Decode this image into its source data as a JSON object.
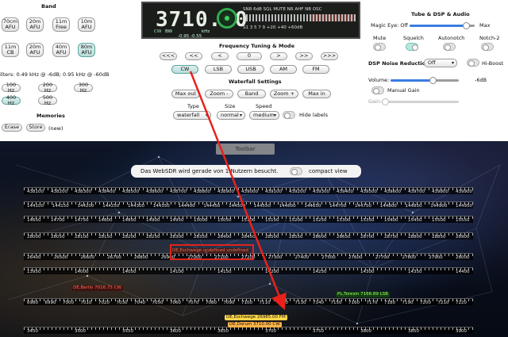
{
  "band": {
    "title": "Band",
    "buttons": [
      {
        "l1": "70cm",
        "l2": "AFU"
      },
      {
        "l1": "20m",
        "l2": "AFU"
      },
      {
        "l1": "11m",
        "l2": "Free"
      },
      {
        "l1": "10m",
        "l2": "AFU"
      },
      {
        "l1": "11m",
        "l2": "CB"
      },
      {
        "l1": "20m",
        "l2": "AFU"
      },
      {
        "l1": "40m",
        "l2": "AFU"
      },
      {
        "l1": "80m",
        "l2": "AFU"
      }
    ],
    "filters_text": "ilters: 0.49 kHz @ -6dB; 0.95 kHz @ -60dB",
    "filter_buttons": [
      "100 Hz",
      "200 Hz",
      "300 Hz",
      "400 Hz",
      "500 Hz"
    ],
    "memories_title": "Memories",
    "memory_buttons": [
      "Erase",
      "Store"
    ],
    "memory_suffix": "(new)"
  },
  "display": {
    "frequency": "3710.00",
    "mode_label": "CW",
    "bw_label": "BW",
    "khz": "kHz",
    "bw_range": "-0.95     -0.55",
    "indicators": "SNR   6dB   SQL   MUTE   NR   AHF   NB   OSC",
    "scale": "S1      3      5      7      9      +20      +40      +60dB"
  },
  "tuning": {
    "title": "Frequency Tuning & Mode",
    "steps": [
      "<<<",
      "<<",
      "<",
      "0",
      ">",
      ">>",
      ">>>"
    ],
    "modes": [
      "CW",
      "LSB",
      "USB",
      "AM",
      "FM"
    ]
  },
  "waterfall": {
    "title": "Waterfall Settings",
    "buttons": [
      "Max out",
      "Zoom -",
      "Band",
      "Zoom +",
      "Max in"
    ],
    "type_label": "Type",
    "size_label": "Size",
    "speed_label": "Speed",
    "type_value": "waterfall",
    "size_value": "normal",
    "speed_value": "medium",
    "hide_labels": "Hide labels"
  },
  "dsp": {
    "title": "Tube & DSP & Audio",
    "magic_eye": "Magic Eye: Off",
    "max": "Max",
    "toggles": [
      "Mute",
      "Squelch",
      "Autonotch",
      "Notch-2"
    ],
    "noise_label": "DSP Noise Reduction:",
    "noise_value": "Off",
    "hiboost": "Hi-Boost",
    "volume_label": "Volume:",
    "volume_value": "-6dB",
    "volume_fraction": 0.62,
    "manual_gain": "Manual Gain",
    "gain_label": "Gain:",
    "magic_fraction": 0.86
  },
  "sdr": {
    "toolbar": "Toolbar",
    "notice": "Das WebSDR wird gerade von 1 Nutzern besucht.",
    "compact": "compact view",
    "scales": [
      {
        "labels": [
          "438100",
          "438200",
          "438300",
          "438400",
          "438500",
          "438600",
          "438700",
          "438800",
          "438900",
          "439000",
          "439100",
          "439200",
          "439300",
          "439400",
          "439500",
          "439600",
          "439700",
          "439800",
          "439900"
        ]
      },
      {
        "labels": [
          "144100",
          "144150",
          "144200",
          "144250",
          "144300",
          "144350",
          "144400",
          "144450",
          "144500",
          "144550",
          "144600",
          "144650",
          "144700",
          "144750",
          "144800",
          "144850",
          "144900",
          "144950"
        ]
      },
      {
        "labels": [
          "14650",
          "14700",
          "14750",
          "14800",
          "14850",
          "14900",
          "14950",
          "15000",
          "15050",
          "15100",
          "15150",
          "15200",
          "15250",
          "15300",
          "15350",
          "15400",
          "15450",
          "15500",
          "15550"
        ]
      },
      {
        "labels": [
          "28000",
          "28050",
          "28100",
          "28150",
          "28200",
          "28250",
          "28300",
          "28350",
          "28400",
          "28450",
          "28500",
          "28550",
          "28600",
          "28650",
          "28700",
          "28750",
          "28800",
          "28850",
          "28900"
        ]
      },
      {
        "labels": [
          "26400",
          "26500",
          "26600",
          "26700",
          "26800",
          "26900",
          "27000",
          "27100",
          "27200",
          "27300",
          "27400",
          "27500",
          "27600",
          "27700",
          "27800",
          "27900",
          "28000"
        ]
      },
      {
        "labels": [
          "13950",
          "14000",
          "14050",
          "14100",
          "14150",
          "14200",
          "14250",
          "14300",
          "14350",
          "14400"
        ]
      },
      {
        "labels": [
          "6980",
          "6990",
          "7000",
          "7010",
          "7020",
          "7030",
          "7040",
          "7050",
          "7060",
          "7070",
          "7080",
          "7090",
          "7100",
          "7110",
          "7120",
          "7130",
          "7140",
          "7150",
          "7160",
          "7170",
          "7180",
          "7190",
          "7200",
          "7210",
          "7220"
        ]
      },
      {
        "labels": [
          "3450",
          "3500",
          "3550",
          "3600",
          "3650",
          "3700",
          "3750",
          "3800",
          "3850",
          "3900"
        ]
      }
    ],
    "tags": [
      {
        "text": "DE,Eschwege undefined undefined",
        "color": "#e07050",
        "bg": "rgba(80,20,10,.7)"
      },
      {
        "text": "DE,Berlin 7016.75 CW",
        "color": "#ff6b5b",
        "bg": "rgba(70,10,10,.7)"
      },
      {
        "text": "PL,Toresin 7166.89 LSB",
        "color": "#9bff6b",
        "bg": "rgba(20,70,10,.85)"
      },
      {
        "text": "DE,Eschwege 26985.00 FM",
        "color": "#111",
        "bg": "#ffd84a"
      },
      {
        "text": "DE,Dorum 3710.00 CW",
        "color": "#111",
        "bg": "#ffb347"
      }
    ]
  },
  "colors": {
    "accent": "#3a7de0",
    "selected": "#5aa59f",
    "arrow": "#e8221b",
    "display": "#1b1d1b"
  }
}
